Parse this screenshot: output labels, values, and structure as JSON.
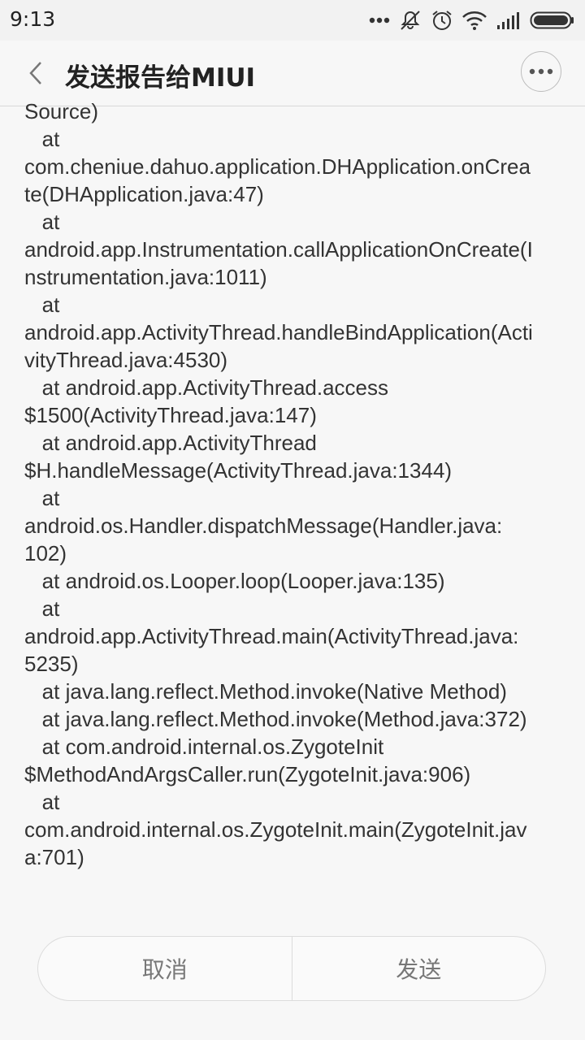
{
  "status_bar": {
    "time": "9:13",
    "icons": [
      "more-dots-icon",
      "mute-icon",
      "alarm-icon",
      "wifi-icon",
      "signal-icon",
      "battery-icon"
    ]
  },
  "header": {
    "title": "发送报告给MIUI",
    "back_icon": "chevron-left-icon",
    "more_icon": "more-icon"
  },
  "log": {
    "lines": [
      "Source)",
      "   at",
      "com.cheniue.dahuo.application.DHApplication.onCrea",
      "te(DHApplication.java:47)",
      "   at",
      "android.app.Instrumentation.callApplicationOnCreate(I",
      "nstrumentation.java:1011)",
      "   at",
      "android.app.ActivityThread.handleBindApplication(Acti",
      "vityThread.java:4530)",
      "   at android.app.ActivityThread.access",
      "$1500(ActivityThread.java:147)",
      "   at android.app.ActivityThread",
      "$H.handleMessage(ActivityThread.java:1344)",
      "   at",
      "android.os.Handler.dispatchMessage(Handler.java:",
      "102)",
      "   at android.os.Looper.loop(Looper.java:135)",
      "   at",
      "android.app.ActivityThread.main(ActivityThread.java:",
      "5235)",
      "   at java.lang.reflect.Method.invoke(Native Method)",
      "   at java.lang.reflect.Method.invoke(Method.java:372)",
      "   at com.android.internal.os.ZygoteInit",
      "$MethodAndArgsCaller.run(ZygoteInit.java:906)",
      "   at",
      "com.android.internal.os.ZygoteInit.main(ZygoteInit.jav",
      "a:701)"
    ]
  },
  "actions": {
    "cancel_label": "取消",
    "send_label": "发送"
  },
  "colors": {
    "background": "#f7f7f7",
    "text": "#333333",
    "button_text": "#777777"
  }
}
